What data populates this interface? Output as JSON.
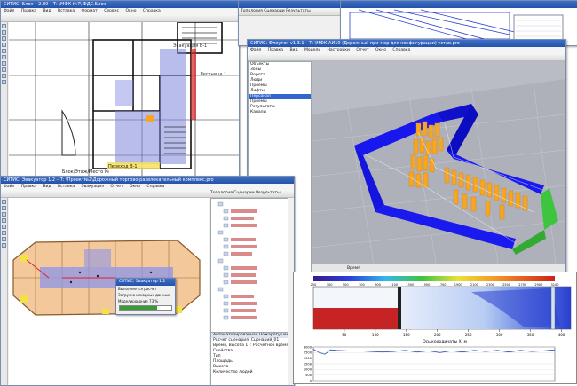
{
  "plan_window": {
    "title": "СИТИС: Блок – 2.30 – Т: \\МФК №7\\ ФДС.Блок",
    "menu": [
      "Файл",
      "Правка",
      "Вид",
      "Вставка",
      "Формат",
      "Сервис",
      "Окно",
      "Справка"
    ],
    "tabs": [
      "Топология",
      "Сценарии",
      "Результаты",
      "Мо"
    ],
    "room_label_1": "Эвакуация В-1",
    "room_label_2": "Лестница 1",
    "room_label_3": "Эвакуация В-1",
    "bottom_label": "Блок/Этаж/Место №",
    "bottom_label_2": "Переход В-1"
  },
  "sim3d_window": {
    "title": "СИТИС: Флоутек v1.3.1 – Т: \\МФК.АИ10 (Дорожный при-мер для конфигурации) устав.pro",
    "menu": [
      "Файл",
      "Правка",
      "Вид",
      "Модель",
      "Настройки",
      "Отчет",
      "Окно",
      "Справка"
    ],
    "tree": [
      "Объекты",
      "Зоны",
      "Ворота",
      "Люди",
      "Проемы",
      "Лифты",
      "Персонал",
      "Проемы",
      "Результаты",
      "Каналы"
    ],
    "status_label": "Время"
  },
  "evac_window": {
    "title": "СИТИС: Эвакуатор 1.2 – Т: \\Проект№2\\Дорожный торгово-развлекательный комплекс.pro",
    "menu": [
      "Файл",
      "Правка",
      "Вид",
      "Вставка",
      "Эвакуация",
      "Отчет",
      "Окно",
      "Справка"
    ],
    "tabs": [
      "Топология",
      "Сценарии",
      "Результаты",
      "Отчет"
    ],
    "dialog_title": "СИТИС: Эвакуатор 1.2",
    "dialog_lines": [
      "Выполняется расчет",
      "Загрузка исходных данных",
      "Моделирование 73 %"
    ],
    "props_header": "Автоматизированная Пожаротушения и эвакуация",
    "props_rows": [
      "Расчет сценария: Сценарий_01",
      "Время, Высота 1Т: Расчетное время, мин",
      "Свойства",
      "Тип",
      "Площадь",
      "Высота",
      "Количество людей"
    ]
  },
  "fds_plot": {
    "colorbar_ticks": [
      "250",
      "300",
      "500",
      "700",
      "900",
      "1100",
      "1300",
      "1500",
      "1700",
      "1900",
      "2100",
      "2300",
      "2500",
      "2700",
      "2900",
      "3100"
    ],
    "x_ticks": [
      "50",
      "100",
      "150",
      "200",
      "250",
      "300",
      "350",
      "400"
    ],
    "x_label": "Ось координаты Х, м",
    "lower_y_ticks": [
      "0",
      "500",
      "1000",
      "1500",
      "2000",
      "2500",
      "3000"
    ]
  },
  "colors": {
    "titlebar": "#2452a8",
    "window_bg": "#f0f0f0",
    "wall_blue": "#1010ee",
    "agent_orange": "#f5a623",
    "floor_grey": "#b9bcc4",
    "plan_highlight": "#7f86dd",
    "exit_green": "#3ec43e",
    "evac_plan_peach": "#f3c89a"
  },
  "chart_data": {
    "type": "line",
    "title": "",
    "xlabel": "Ось координаты Х, м",
    "ylabel": "",
    "xlim": [
      0,
      420
    ],
    "ylim": [
      0,
      3000
    ],
    "x": [
      0,
      10,
      20,
      30,
      40,
      60,
      80,
      100,
      120,
      140,
      150,
      160,
      180,
      200,
      220,
      240,
      260,
      280,
      300,
      320,
      340,
      360,
      380,
      400,
      420
    ],
    "series": [
      {
        "name": "",
        "values": [
          2800,
          2500,
          2350,
          2750,
          2700,
          2650,
          2650,
          2600,
          2550,
          2600,
          2650,
          2700,
          2550,
          2650,
          2500,
          2650,
          2550,
          2700,
          2600,
          2700,
          2550,
          2700,
          2600,
          2650,
          2750
        ]
      }
    ],
    "grid": true
  }
}
